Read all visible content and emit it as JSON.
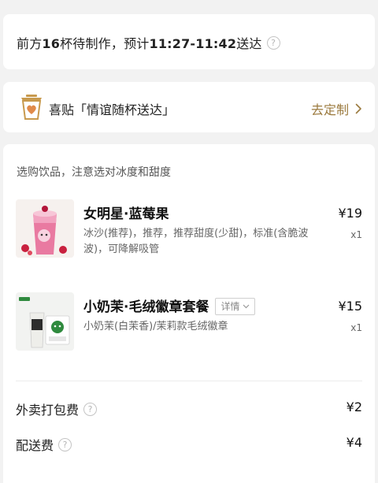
{
  "wait_status": {
    "prefix": "前方",
    "count": "16",
    "middle": "杯待制作，预计",
    "time_range": "11:27-11:42",
    "suffix": "送达"
  },
  "gift": {
    "title": "喜贴「情谊随杯送达」",
    "link_label": "去定制",
    "accent_color": "#9b7a3e"
  },
  "order": {
    "hint": "选购饮品，注意选对冰度和甜度",
    "items": [
      {
        "name": "女明星·蓝莓果",
        "desc": "冰沙(推荐)，推荐，推荐甜度(少甜)，标准(含脆波波)，可降解吸管",
        "price": "¥19",
        "qty": "x1"
      },
      {
        "name": "小奶茉·毛绒徽章套餐",
        "detail_label": "详情",
        "desc": "小奶茉(白茉香)/茉莉款毛绒徽章",
        "price": "¥15",
        "qty": "x1"
      }
    ],
    "fees": [
      {
        "label": "外卖打包费",
        "value": "¥2"
      },
      {
        "label": "配送费",
        "value": "¥4"
      }
    ]
  },
  "icons": {
    "help": "question-circle-icon",
    "chevron": "chevron-right-icon",
    "cup": "cup-heart-icon"
  }
}
